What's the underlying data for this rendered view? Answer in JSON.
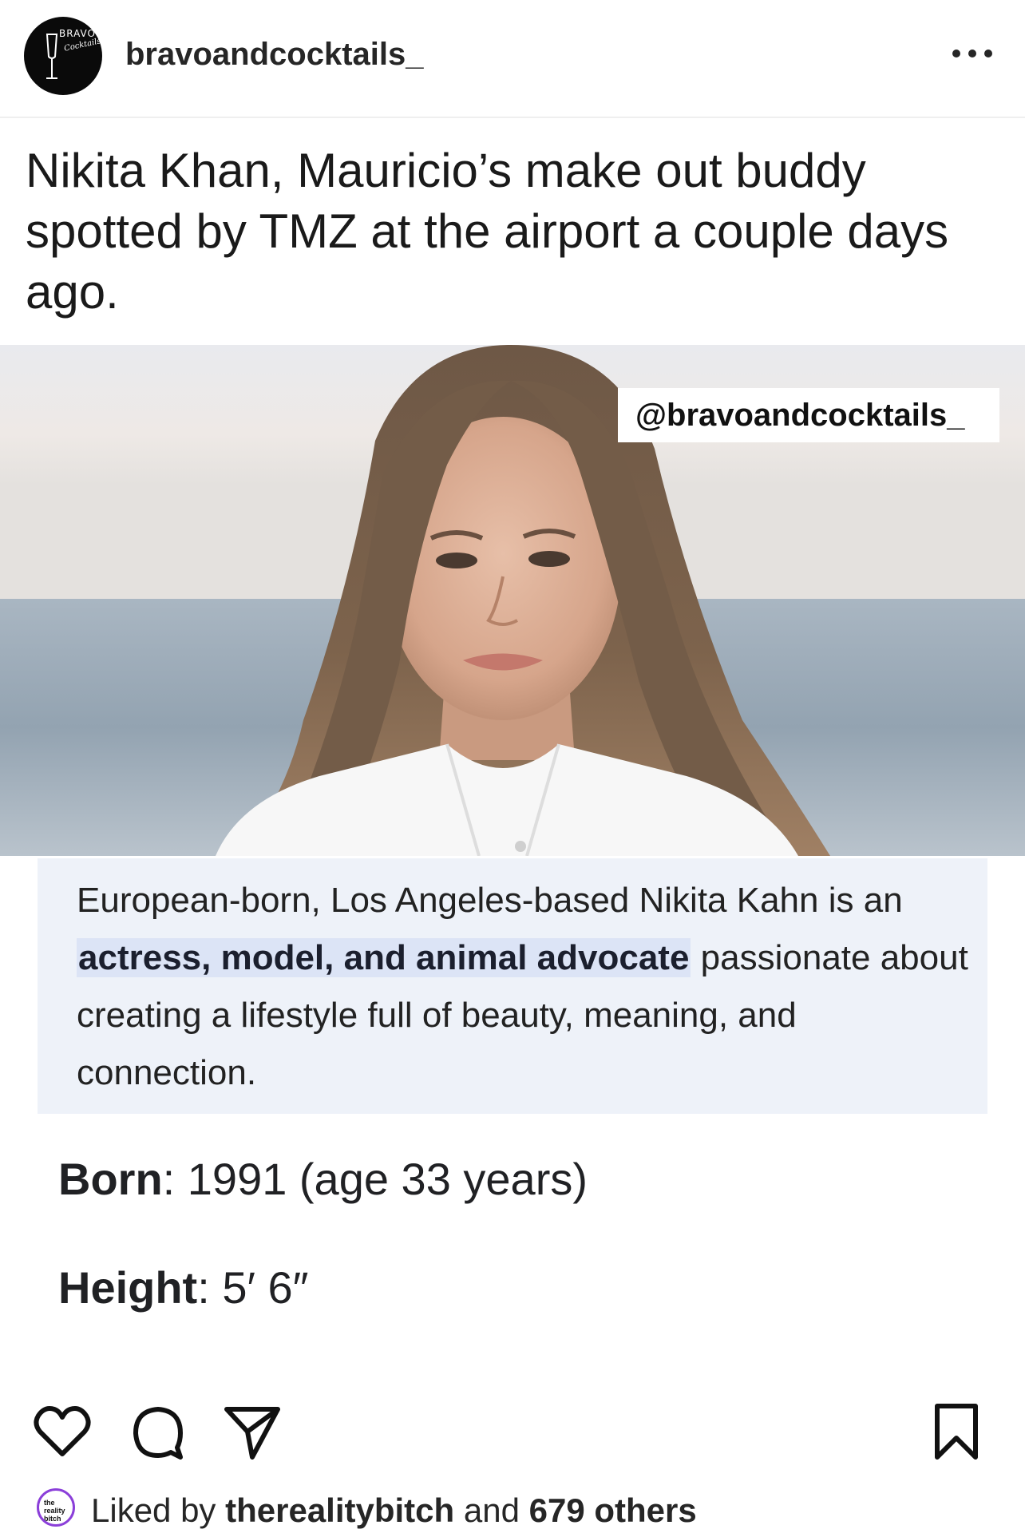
{
  "post": {
    "username": "bravoandcocktails_",
    "avatar_text": "BRAVO",
    "avatar_subtext": "Cocktails",
    "caption": "Nikita Khan, Mauricio’s make out buddy spotted by TMZ at the airport a couple days ago.",
    "watermark": "@bravoandcocktails_",
    "bio_part1": "European-born, Los Angeles-based Nikita Kahn is an ",
    "bio_highlight": "actress, model, and animal advocate",
    "bio_part2": " passionate about creating a lifestyle full of beauty, meaning, and connection.",
    "born_label": "Born",
    "born_value": ": 1991 (age 33 years)",
    "height_label": "Height",
    "height_value": ": 5′ 6″"
  },
  "actions": {
    "like": "heart-icon",
    "comment": "comment-icon",
    "share": "paper-plane-icon",
    "save": "bookmark-icon",
    "more": "more-dots-icon"
  },
  "likes": {
    "prefix": "Liked by ",
    "user": "therealitybitch",
    "middle": " and ",
    "count": "679 others",
    "avatar_text": "the reality bitch"
  }
}
